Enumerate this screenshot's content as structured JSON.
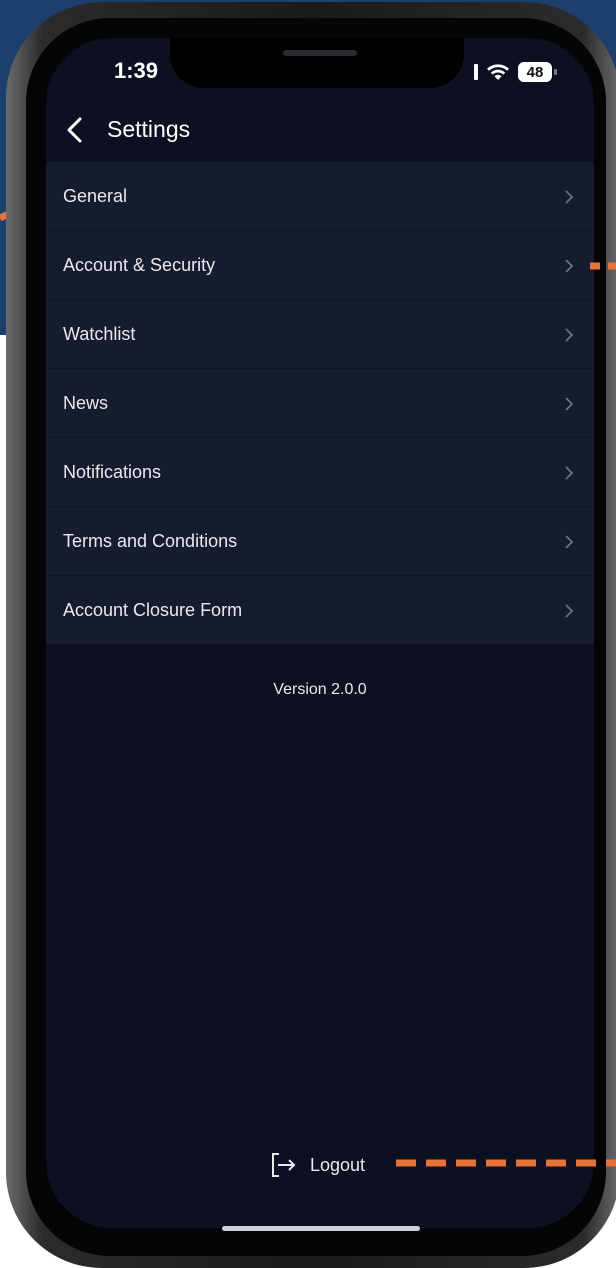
{
  "status_bar": {
    "time": "1:39",
    "battery": "48"
  },
  "header": {
    "title": "Settings"
  },
  "menu": {
    "items": [
      {
        "label": "General"
      },
      {
        "label": "Account & Security"
      },
      {
        "label": "Watchlist"
      },
      {
        "label": "News"
      },
      {
        "label": "Notifications"
      },
      {
        "label": "Terms and Conditions"
      },
      {
        "label": "Account Closure Form"
      }
    ]
  },
  "footer": {
    "version": "Version 2.0.0",
    "logout_label": "Logout"
  },
  "colors": {
    "screen_background": "#0c1020",
    "row_background": "#161b2e",
    "banner": "#1d3f6e",
    "annotation_dash": "#e8733a"
  }
}
